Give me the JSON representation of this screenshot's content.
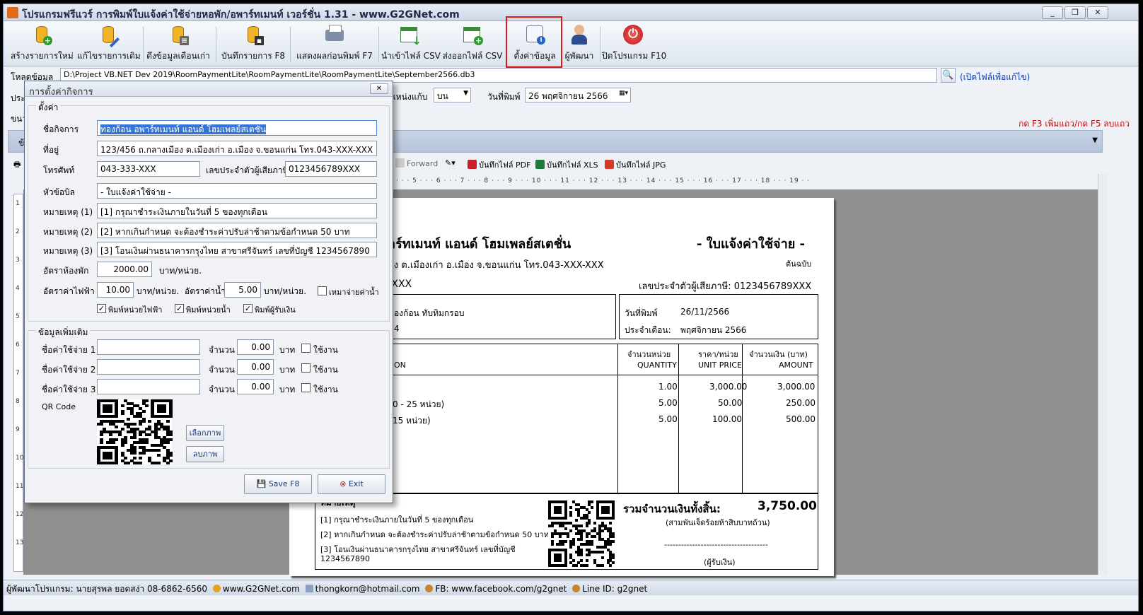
{
  "window": {
    "title": "โปรแกรมฟรีแวร์ การพิมพ์ใบแจ้งค่าใช้จ่ายหอพัก/อพาร์ทเมนท์ เวอร์ชั่น 1.31 - www.G2GNet.com",
    "min_icon": "minimize-icon",
    "max_icon": "maximize-icon",
    "close_icon": "close-icon"
  },
  "toolbar": {
    "items": [
      {
        "label": "สร้างรายการใหม่",
        "icon": "database-add-icon"
      },
      {
        "label": "แก้ไขรายการเดิม",
        "icon": "database-edit-icon"
      },
      {
        "label": "ดึงข้อมูลเดือนเก่า",
        "icon": "database-list-icon"
      },
      {
        "label": "บันทึกรายการ F8",
        "icon": "database-save-icon"
      },
      {
        "label": "แสดงผลก่อนพิมพ์ F7",
        "icon": "printer-icon"
      },
      {
        "label": "นำเข้าไฟล์ CSV",
        "icon": "spreadsheet-import-icon"
      },
      {
        "label": "ส่งออกไฟล์ CSV",
        "icon": "spreadsheet-export-icon"
      },
      {
        "label": "ตั้งค่าข้อมูล",
        "icon": "settings-info-icon"
      },
      {
        "label": "ผู้พัฒนา",
        "icon": "developer-person-icon"
      },
      {
        "label": "ปิดโปรแกรม F10",
        "icon": "power-icon"
      }
    ]
  },
  "pathrow": {
    "label": "โหลดข้อมูล",
    "path": "D:\\Project VB.NET Dev 2019\\RoomPaymentLite\\RoomPaymentLite\\RoomPaymentLite\\September2566.db3",
    "open_link": "(เปิดไฟล์เพื่อแก้ไข)"
  },
  "row2": {
    "label_left": "ประ",
    "pos_label": "แหน่งแก้บ",
    "pos_value": "บน",
    "date_label": "วันที่พิมพ์",
    "date_value": "26 พฤศจิกายน  2566"
  },
  "row3": {
    "label_left": "ขนา",
    "hint": "กด F3 เพิ่มแถว/กด F5 ลบแถว"
  },
  "strip": {
    "label": "ข้"
  },
  "viewer": {
    "forward": "Forward",
    "save_pdf": "บันทึกไฟล์ PDF",
    "save_xls": "บันทึกไฟล์ XLS",
    "save_jpg": "บันทึกไฟล์ JPG",
    "ruler": "· · · 5 · · · 6 · · · 7 · · · 8 · · · 9 · · · 10 · · · 11 · · · 12 · · · 13 · · · 14 · · · 15 · · · 16 · · · 17 · · · 18 · · · 19 · ·",
    "vruler": [
      "1",
      "2",
      "3",
      "4",
      "5",
      "6",
      "7",
      "8",
      "9",
      "10",
      "11",
      "12",
      "13"
    ]
  },
  "invoice": {
    "company": "าร์ทเมนท์ แอนด์ โฮมเพลย์สเตชั่น",
    "doc_title": "- ใบแจ้งค่าใช้จ่าย -",
    "address": "อง ต.เมืองเก่า อ.เมือง จ.ขอนแก่น โทร.043-XXX-XXX",
    "original": "ต้นฉบับ",
    "phone_partial": "-XXX",
    "taxid": "เลขประจำตัวผู้เสียภาษี: 0123456789XXX",
    "tenant": "องก้อน ทับทิมกรอบ",
    "room_partial": "4",
    "date_label": "วันที่พิมพ์",
    "date_value": "26/11/2566",
    "month_label": "ประจำเดือน:",
    "month_value": "พฤศจิกายน 2566",
    "headers": {
      "desc": "ON",
      "qty_th": "จำนวนหน่วย",
      "qty_en": "QUANTITY",
      "price_th": "ราคา/หน่วย",
      "price_en": "UNIT PRICE",
      "amt_th": "จำนวนเงิน (บาท)",
      "amt_en": "AMOUNT"
    },
    "rows": [
      {
        "desc": "",
        "qty": "1.00",
        "price": "3,000.00",
        "amount": "3,000.00"
      },
      {
        "desc": "0 - 25 หน่วย)",
        "qty": "5.00",
        "price": "50.00",
        "amount": "250.00"
      },
      {
        "desc": "15 หน่วย)",
        "qty": "5.00",
        "price": "100.00",
        "amount": "500.00"
      }
    ],
    "notes_title": "หมายเหตุ",
    "notes": [
      "[1] กรุณาชำระเงินภายในวันที่ 5 ของทุกเดือน",
      "[2] หากเกินกำหนด จะต้องชำระค่าปรับล่าช้าตามข้อกำหนด 50 บาท",
      "[3] โอนเงินผ่านธนาคารกรุงไทย สาขาศรีจันทร์ เลขที่บัญชี",
      "1234567890"
    ],
    "total_label": "รวมจำนวนเงินทั้งสิ้น:",
    "total_value": "3,750.00",
    "total_words": "(สามพันเจ็ดร้อยห้าสิบบาทถ้วน)",
    "sign_line": "-------------------------------------",
    "receiver": "(ผู้รับเงิน)"
  },
  "dialog": {
    "title": "การตั้งค่ากิจการ",
    "close": "✕",
    "group1": "ตั้งค่า",
    "fields": {
      "business_label": "ชื่อกิจการ",
      "business": "ทองก้อน อพาร์ทเมนท์ แอนด์ โฮมเพลย์สเตชั่น",
      "address_label": "ที่อยู่",
      "address": "123/456 ถ.กลางเมือง ต.เมืองเก่า อ.เมือง จ.ขอนแก่น โทร.043-XXX-XXX",
      "phone_label": "โทรศัพท์",
      "phone": "043-333-XXX",
      "tax_label": "เลขประจำตัวผู้เสียภาษี",
      "tax": "0123456789XXX",
      "header_label": "หัวข้อบิล",
      "header": "- ใบแจ้งค่าใช้จ่าย -",
      "note1_label": "หมายเหตุ (1)",
      "note1": "[1] กรุณาชำระเงินภายในวันที่ 5 ของทุกเดือน",
      "note2_label": "หมายเหตุ (2)",
      "note2": "[2] หากเกินกำหนด จะต้องชำระค่าปรับล่าช้าตามข้อกำหนด 50 บาท",
      "note3_label": "หมายเหตุ (3)",
      "note3": "[3] โอนเงินผ่านธนาคารกรุงไทย สาขาศรีจันทร์ เลขที่บัญชี 1234567890",
      "room_rate_label": "อัตราห้องพัก",
      "room_rate": "2000.00",
      "per_unit": "บาท/หน่วย.",
      "elec_label": "อัตราค่าไฟฟ้า",
      "elec": "10.00",
      "water_label": "อัตราค่าน้ำ",
      "water": "5.00",
      "flat_label": "เหมาจ่ายค่าน้ำ",
      "print_elec": "พิมพ์หน่วยไฟฟ้า",
      "print_water": "พิมพ์หน่วยน้ำ",
      "print_receiver": "พิมพ์ผู้รับเงิน"
    },
    "group2": "ข้อมูลเพิ่มเติม",
    "extras": [
      {
        "label": "ชื่อค่าใช้จ่าย 1",
        "amount_label": "จำนวน",
        "amount": "0.00",
        "unit": "บาท",
        "use": "ใช้งาน"
      },
      {
        "label": "ชื่อค่าใช้จ่าย 2",
        "amount_label": "จำนวน",
        "amount": "0.00",
        "unit": "บาท",
        "use": "ใช้งาน"
      },
      {
        "label": "ชื่อค่าใช้จ่าย 3",
        "amount_label": "จำนวน",
        "amount": "0.00",
        "unit": "บาท",
        "use": "ใช้งาน"
      }
    ],
    "qr_label": "QR Code",
    "choose_image": "เลือกภาพ",
    "delete_image": "ลบภาพ",
    "save": "Save F8",
    "exit": "Exit"
  },
  "status": {
    "dev": "ผู้พัฒนาโปรแกรม: นายสุรพล ยอดสง่า 08-6862-6560",
    "web": "www.G2GNet.com",
    "email": "thongkorn@hotmail.com",
    "fb": "FB: www.facebook.com/g2gnet",
    "line": "Line ID: g2gnet"
  }
}
